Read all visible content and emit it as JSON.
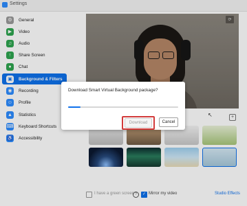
{
  "window": {
    "title": "Settings",
    "accent": "#0e71eb"
  },
  "sidebar": {
    "items": [
      {
        "label": "General",
        "icon": "gear-icon",
        "color": "#9a9a9a",
        "active": false
      },
      {
        "label": "Video",
        "icon": "video-camera-icon",
        "color": "#2ea44f",
        "active": false
      },
      {
        "label": "Audio",
        "icon": "headphones-icon",
        "color": "#2ea44f",
        "active": false
      },
      {
        "label": "Share Screen",
        "icon": "share-screen-icon",
        "color": "#2ea44f",
        "active": false
      },
      {
        "label": "Chat",
        "icon": "chat-bubble-icon",
        "color": "#2ea44f",
        "active": false
      },
      {
        "label": "Background & Filters",
        "icon": "background-person-icon",
        "color": "#0e71eb",
        "active": true
      },
      {
        "label": "Recording",
        "icon": "record-icon",
        "color": "#2d8cff",
        "active": false
      },
      {
        "label": "Profile",
        "icon": "person-icon",
        "color": "#2d8cff",
        "active": false
      },
      {
        "label": "Statistics",
        "icon": "statistics-icon",
        "color": "#2d8cff",
        "active": false
      },
      {
        "label": "Keyboard Shortcuts",
        "icon": "keyboard-icon",
        "color": "#2d8cff",
        "active": false
      },
      {
        "label": "Accessibility",
        "icon": "accessibility-icon",
        "color": "#2d8cff",
        "active": false
      }
    ]
  },
  "dialog": {
    "message": "Download Smart Virtual Background package?",
    "progress": 0.11,
    "download_label": "Download",
    "cancel_label": "Cancel"
  },
  "footer": {
    "green_screen_label": "I have a green screen",
    "mirror_label": "Mirror my video",
    "studio_effects_label": "Studio Effects"
  }
}
